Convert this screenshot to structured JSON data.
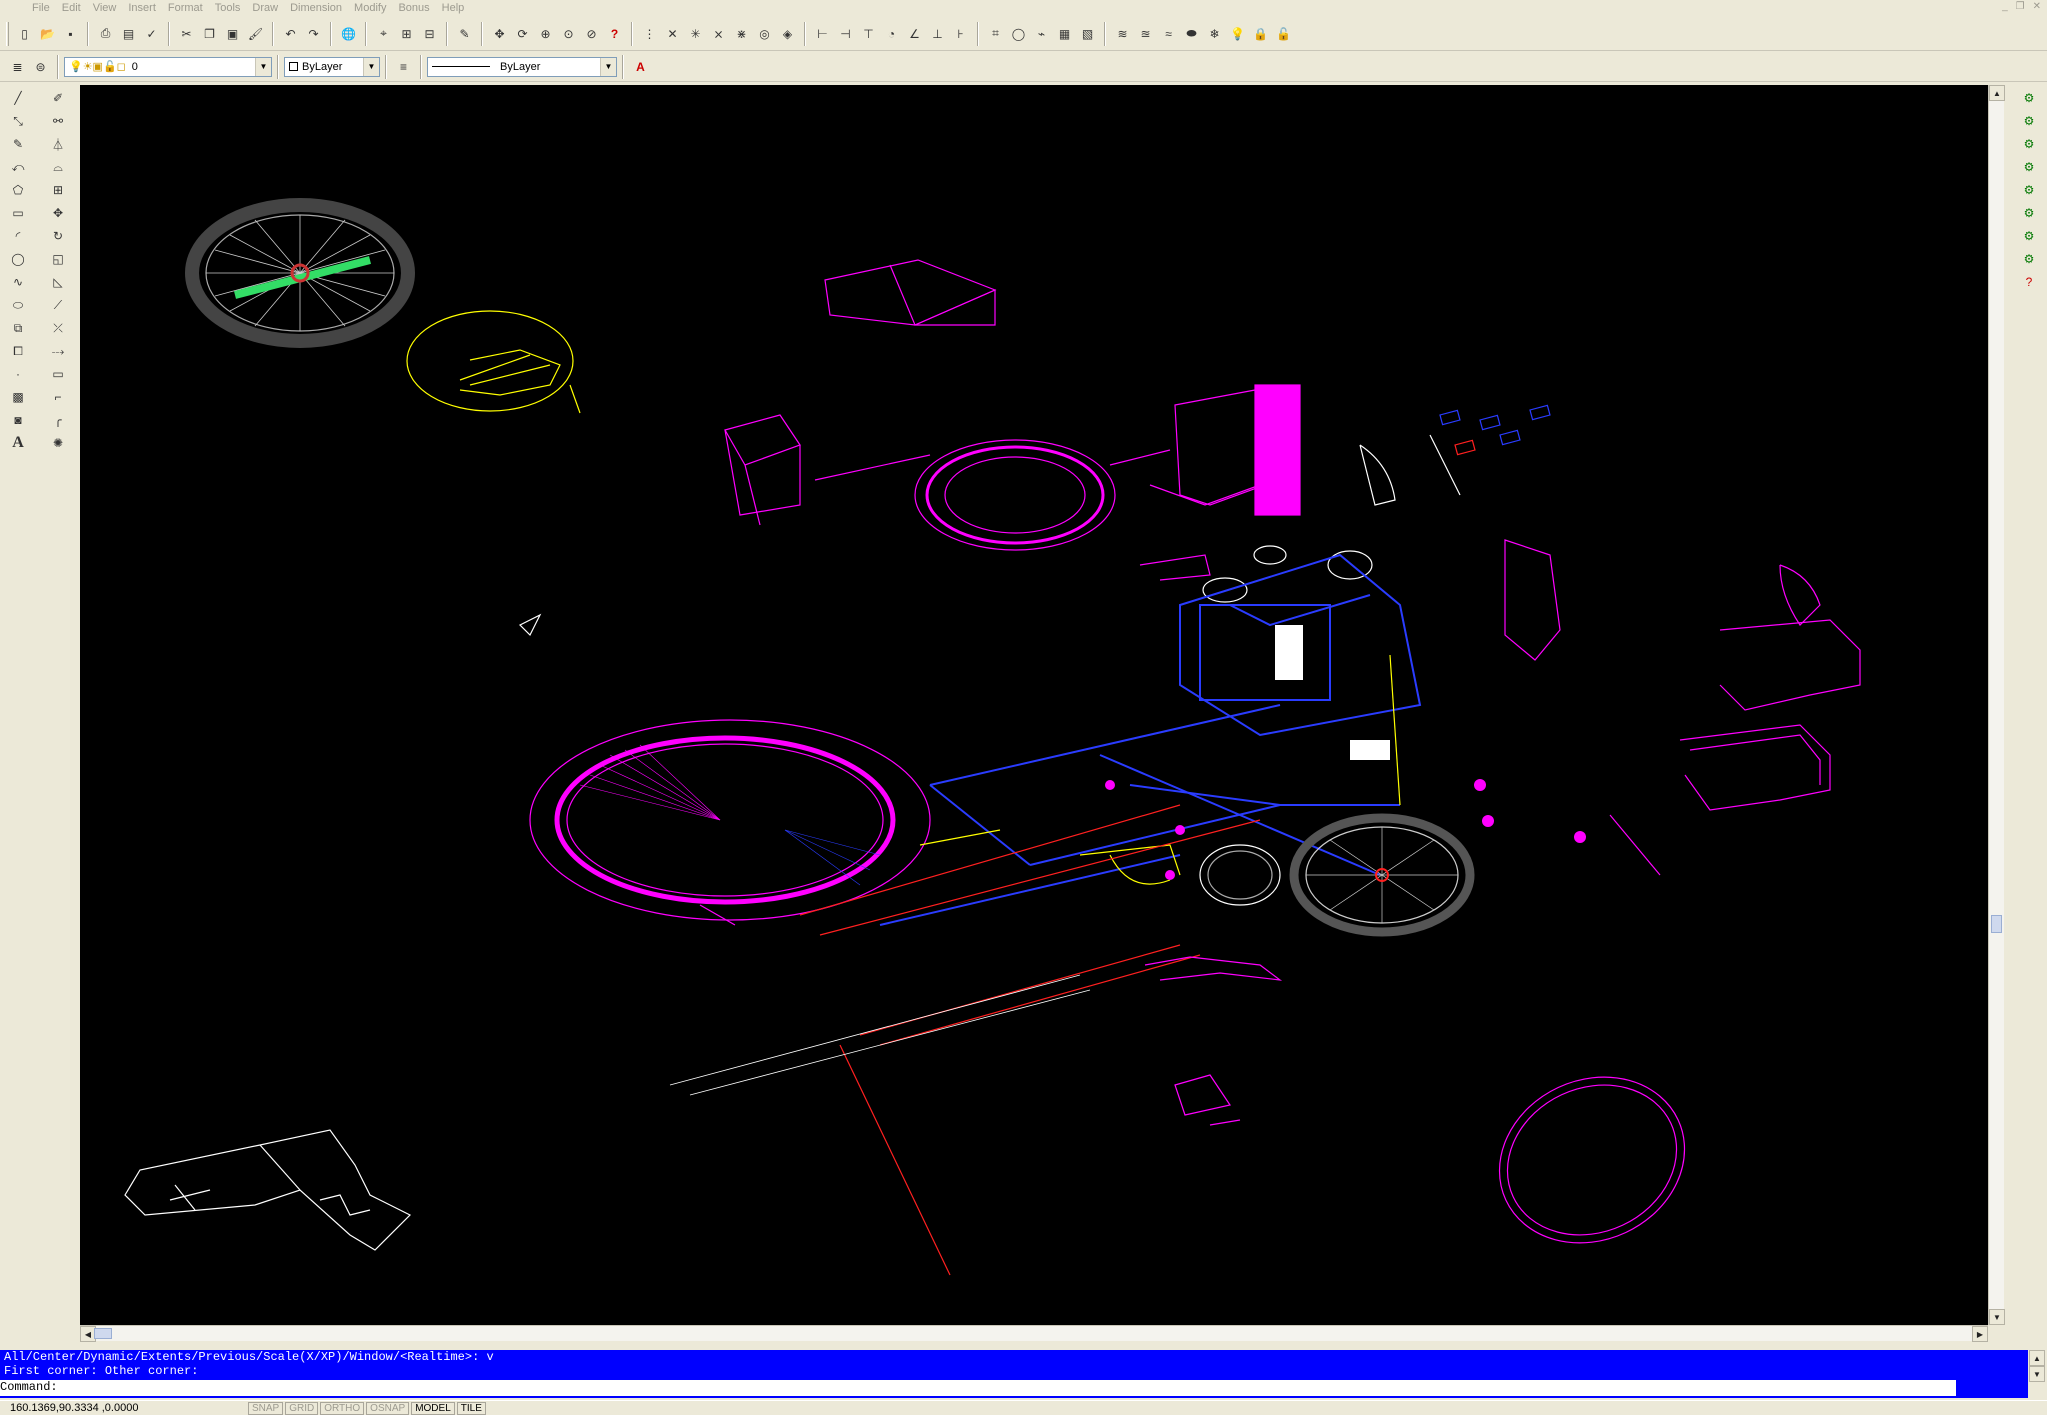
{
  "menu": [
    "File",
    "Edit",
    "View",
    "Insert",
    "Format",
    "Tools",
    "Draw",
    "Dimension",
    "Modify",
    "Bonus",
    "Help"
  ],
  "window_controls": [
    "_",
    "❐",
    "✕"
  ],
  "layer_toolbar": {
    "layer_value": "0",
    "color_value": "ByLayer",
    "linetype_value": "ByLayer"
  },
  "command": {
    "line1": "All/Center/Dynamic/Extents/Previous/Scale(X/XP)/Window/<Realtime>: v",
    "line2": "First corner: Other corner:",
    "prompt": "Command:"
  },
  "status": {
    "coords": "160.1369,90.3334 ,0.0000",
    "buttons": [
      {
        "label": "SNAP",
        "on": false
      },
      {
        "label": "GRID",
        "on": false
      },
      {
        "label": "ORTHO",
        "on": false
      },
      {
        "label": "OSNAP",
        "on": false
      },
      {
        "label": "MODEL",
        "on": true
      },
      {
        "label": "TILE",
        "on": true
      }
    ]
  },
  "icons": {
    "std_toolbar": [
      "new-icon",
      "open-icon",
      "save-icon",
      "print-icon",
      "preview-icon",
      "spell-icon",
      "cut-icon",
      "copy-icon",
      "paste-icon",
      "match-properties-icon",
      "undo-icon",
      "redo-icon",
      "hyperlink-icon",
      "snap-from-icon",
      "ucs-icon",
      "distance-icon",
      "redraw-icon",
      "pan-icon",
      "zoom-realtime-icon",
      "zoom-window-icon",
      "zoom-previous-icon",
      "help-icon"
    ],
    "draw_tools": [
      "line-icon",
      "construction-line-icon",
      "polyline-icon",
      "polygon-icon",
      "rectangle-icon",
      "arc-icon",
      "circle-icon",
      "spline-icon",
      "ellipse-icon",
      "insert-block-icon",
      "make-block-icon",
      "point-icon",
      "hatch-icon",
      "region-icon",
      "text-icon"
    ],
    "modify_tools": [
      "erase-icon",
      "copy-object-icon",
      "mirror-icon",
      "offset-icon",
      "array-icon",
      "move-icon",
      "rotate-icon",
      "scale-icon",
      "stretch-icon",
      "lengthen-icon",
      "trim-icon",
      "extend-icon",
      "break-icon",
      "chamfer-icon",
      "fillet-icon",
      "explode-icon"
    ]
  },
  "colors": {
    "canvas": "#000000",
    "magenta": "#ff00ff",
    "blue": "#2a3cff",
    "yellow": "#ffff00",
    "red": "#ff2020",
    "white": "#ffffff",
    "command_bg": "#0000ff"
  }
}
